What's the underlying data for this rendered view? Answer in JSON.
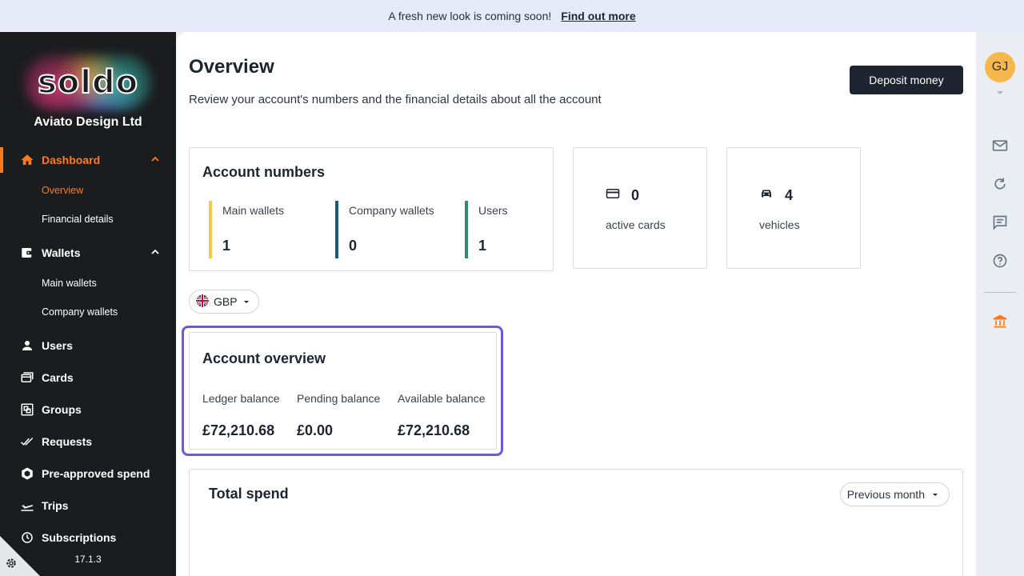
{
  "banner": {
    "text": "A fresh new look is coming soon!",
    "link": "Find out more"
  },
  "sidebar": {
    "logo": "soldo",
    "company": "Aviato Design Ltd",
    "dashboard": {
      "label": "Dashboard",
      "sub": [
        "Overview",
        "Financial details"
      ]
    },
    "wallets": {
      "label": "Wallets",
      "sub": [
        "Main wallets",
        "Company wallets"
      ]
    },
    "users": "Users",
    "cards": "Cards",
    "groups": "Groups",
    "requests": "Requests",
    "preapproved": "Pre-approved spend",
    "trips": "Trips",
    "subscriptions": "Subscriptions",
    "version": "17.1.3"
  },
  "header": {
    "title": "Overview",
    "subtitle": "Review your account's numbers and the financial details about all the account",
    "deposit_button": "Deposit money"
  },
  "account_numbers": {
    "title": "Account numbers",
    "metrics": [
      {
        "label": "Main wallets",
        "value": "1",
        "color": "#f2c94c"
      },
      {
        "label": "Company wallets",
        "value": "0",
        "color": "#1d5a7a"
      },
      {
        "label": "Users",
        "value": "1",
        "color": "#2e8b6e"
      }
    ]
  },
  "cards_card": {
    "value": "0",
    "caption": "active cards"
  },
  "vehicles_card": {
    "value": "4",
    "caption": "vehicles"
  },
  "currency": {
    "code": "GBP"
  },
  "account_overview": {
    "title": "Account overview",
    "ledger": {
      "label": "Ledger balance",
      "value": "£72,210.68"
    },
    "pending": {
      "label": "Pending balance",
      "value": "£0.00"
    },
    "available": {
      "label": "Available balance",
      "value": "£72,210.68"
    }
  },
  "total_spend": {
    "title": "Total spend",
    "period": "Previous month"
  },
  "user": {
    "initials": "GJ"
  },
  "colors": {
    "accent": "#ff7a1a",
    "highlight": "#6f59d8",
    "sidebar_bg": "#1b1c1e",
    "button_bg": "#1e2530"
  }
}
